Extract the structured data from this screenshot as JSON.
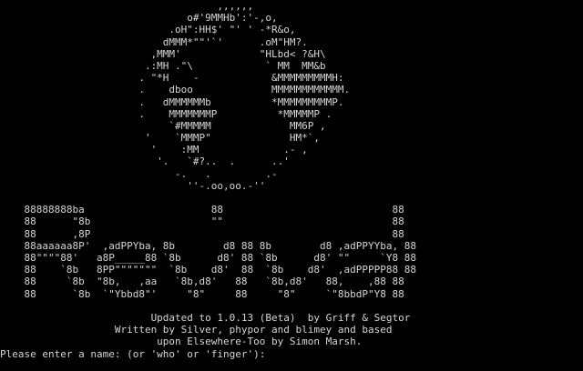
{
  "terminal": {
    "art_lines": [
      "                                    ,,,,,,",
      "                               o#'9MMHb':'-,o,",
      "                            .oH\":HH$' \"' ' -*R&o,",
      "                           dMMM*\"\"'`'      .oM\"HM?.",
      "                         ,MMM'             \"HLbd< ?&H\\",
      "                        .:MH .\"\\            ` MM  MM&b",
      "                       . \"*H    -            &MMMMMMMMMH:",
      "                       .    dboo             MMMMMMMMMMMM.",
      "                       .   dMMMMMMb          *MMMMMMMMMP.",
      "                       .    MMMMMMMP          *MMMMMP .",
      "                            `#MMMMM             MM6P ,",
      "                        '    `MMMP\"             HM*`,",
      "                         '    :MM              .- ,",
      "                          '.   `#?..  .      ..'",
      "                             -.   .         .-",
      "                               ''-.oo,oo.-''",
      "",
      "    88888888ba                     88                            88",
      "    88      \"8b                    \"\"                            88",
      "    88      ,8P                                                  88",
      "    88aaaaaa8P'  ,adPPYba, 8b        d8 88 8b        d8 ,adPPYYba, 88",
      "    88\"\"\"\"88'   a8P_____88 `8b      d8' 88 `8b      d8' \"\"     `Y8 88",
      "    88    `8b   8PP\"\"\"\"\"\"\"  `8b    d8'  88  `8b    d8'  ,adPPPPP88 88",
      "    88     `8b  \"8b,   ,aa   `8b,d8'   88   `8b,d8'   88,    ,88 88",
      "    88      `8b  `\"Ybbd8\"'     \"8\"     88     \"8\"     `\"8bbdP\"Y8 88",
      "",
      "                         Updated to 1.0.13 (Beta)  by Griff & Segtor",
      "                   Written by Silver, phypor and blimey and based",
      "                          upon Elsewhere-Too by Simon Marsh."
    ],
    "prompt": "Please enter a name: (or 'who' or 'finger'):"
  }
}
